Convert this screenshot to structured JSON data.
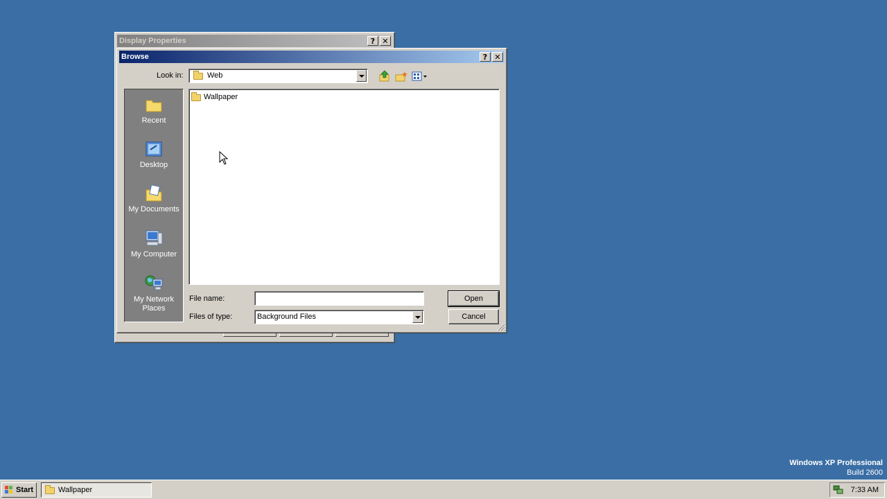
{
  "display_properties": {
    "title": "Display Properties",
    "help_glyph": "?",
    "close_glyph": "✕"
  },
  "browse": {
    "title": "Browse",
    "help_glyph": "?",
    "close_glyph": "✕",
    "look_in_label": "Look in:",
    "look_in_value": "Web",
    "places": [
      {
        "label": "Recent",
        "icon": "recent-folder-icon"
      },
      {
        "label": "Desktop",
        "icon": "desktop-icon"
      },
      {
        "label": "My Documents",
        "icon": "my-documents-icon"
      },
      {
        "label": "My Computer",
        "icon": "my-computer-icon"
      },
      {
        "label": "My Network Places",
        "icon": "my-network-places-icon"
      }
    ],
    "files": [
      {
        "name": "Wallpaper",
        "icon": "folder-icon"
      }
    ],
    "file_name_label": "File name:",
    "file_name_value": "",
    "file_type_label": "Files of type:",
    "file_type_value": "Background Files",
    "open_label": "Open",
    "cancel_label": "Cancel"
  },
  "desktop": {
    "os_name": "Windows XP Professional",
    "build": "Build 2600"
  },
  "taskbar": {
    "start_label": "Start",
    "tasks": [
      {
        "label": "Wallpaper"
      }
    ],
    "clock": "7:33 AM"
  }
}
